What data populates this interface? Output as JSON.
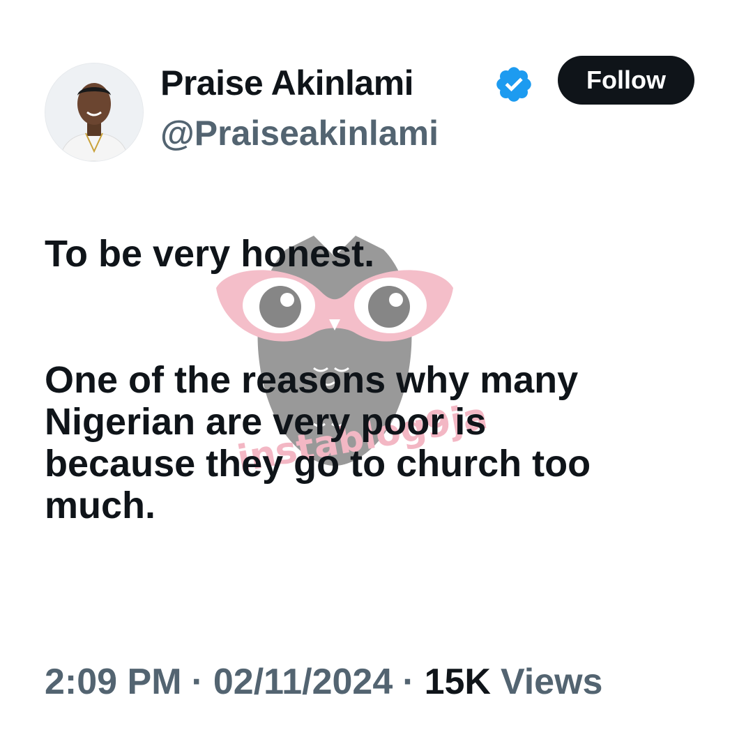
{
  "author": {
    "name": "Praise Akinlami",
    "handle": "@Praiseakinlami",
    "verified_icon": "verified-badge-icon",
    "verified_color": "#1d9bf0"
  },
  "follow_button": {
    "label": "Follow"
  },
  "tweet": {
    "lines": [
      "To be very honest.",
      "One of the reasons why many",
      "Nigerian are very poor is",
      "because they go to church too",
      "much."
    ]
  },
  "meta": {
    "time": "2:09 PM",
    "date": "02/11/2024",
    "separator": "·",
    "views_count": "15K",
    "views_label": "Views"
  },
  "watermark": {
    "text": "instablog9ja",
    "icon": "owl-with-glasses-icon"
  },
  "colors": {
    "text_primary": "#0f1419",
    "text_secondary": "#536471",
    "button_bg": "#0f1419",
    "button_text": "#ffffff",
    "watermark_pink": "#f3b7c4",
    "watermark_gray": "#7a7a7a"
  }
}
